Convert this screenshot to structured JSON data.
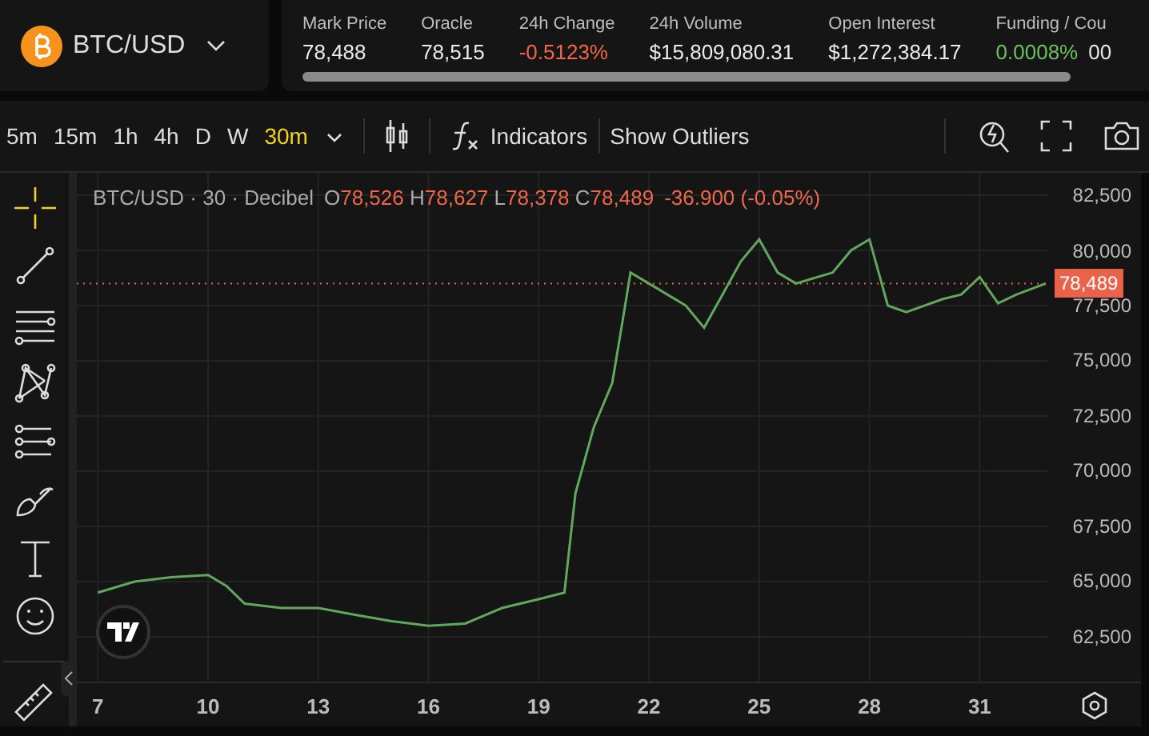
{
  "market": {
    "symbol": "BTC/USD"
  },
  "stats": [
    {
      "label": "Mark Price",
      "value": "78,488",
      "color": "#ececec"
    },
    {
      "label": "Oracle",
      "value": "78,515",
      "color": "#ececec"
    },
    {
      "label": "24h Change",
      "value": "-0.5123%",
      "color": "#f0664a"
    },
    {
      "label": "24h Volume",
      "value": "$15,809,080.31",
      "color": "#ececec"
    },
    {
      "label": "Open Interest",
      "value": "$1,272,384.17",
      "color": "#ececec"
    },
    {
      "label": "Funding / Cou",
      "value": "0.0008%",
      "extra": "00",
      "color": "#6cc05f"
    }
  ],
  "timeframes": [
    {
      "label": "5m",
      "selected": false
    },
    {
      "label": "15m",
      "selected": false
    },
    {
      "label": "1h",
      "selected": false
    },
    {
      "label": "4h",
      "selected": false
    },
    {
      "label": "D",
      "selected": false
    },
    {
      "label": "W",
      "selected": false
    },
    {
      "label": "30m",
      "selected": true
    }
  ],
  "toolbar": {
    "indicators": "Indicators",
    "outliers": "Show Outliers"
  },
  "tools": [
    {
      "selected": true
    },
    {
      "selected": false
    },
    {
      "selected": false
    },
    {
      "selected": false
    },
    {
      "selected": false
    },
    {
      "selected": false
    },
    {
      "selected": false
    },
    {
      "selected": false
    },
    {
      "selected": false
    }
  ],
  "legend": {
    "title": "BTC/USD · 30 · Decibel",
    "ohlc": [
      {
        "label": "O",
        "value": "78,526"
      },
      {
        "label": "H",
        "value": "78,627"
      },
      {
        "label": "L",
        "value": "78,378"
      },
      {
        "label": "C",
        "value": "78,489"
      }
    ],
    "change": "-36.900 (-0.05%)"
  },
  "price_tag": "78,489",
  "chart_data": {
    "type": "line",
    "x": [
      7,
      8,
      9,
      10,
      10.5,
      11,
      12,
      13,
      14,
      15,
      16,
      17,
      18,
      19,
      19.7,
      20,
      20.5,
      21,
      21.3,
      21.5,
      22,
      23,
      23.5,
      24,
      24.5,
      25,
      25.5,
      26,
      27,
      27.5,
      28,
      28.5,
      29,
      30,
      30.5,
      31,
      31.5,
      32,
      32.8
    ],
    "series": [
      {
        "color": "#5fa85c",
        "values": [
          64500,
          65000,
          65200,
          65300,
          64800,
          64000,
          63800,
          63800,
          63500,
          63200,
          63000,
          63100,
          63800,
          64200,
          64500,
          69000,
          72000,
          74000,
          77000,
          79000,
          78500,
          77500,
          76500,
          78000,
          79500,
          80500,
          79000,
          78500,
          79000,
          80000,
          80500,
          77500,
          77200,
          77800,
          78000,
          78800,
          77600,
          78000,
          78500
        ]
      }
    ],
    "grid": true,
    "ref_lines": [
      {
        "axis": "y",
        "value": 78500,
        "color": "#e8634a"
      }
    ],
    "xlim": [
      6.43,
      35.39
    ],
    "ylim": [
      60470,
      83515
    ],
    "xticks": [
      7,
      10,
      13,
      16,
      19,
      22,
      25,
      28,
      31
    ],
    "yticks": [
      {
        "value": 62500,
        "label": "62,500"
      },
      {
        "value": 65000,
        "label": "65,000"
      },
      {
        "value": 67500,
        "label": "67,500"
      },
      {
        "value": 70000,
        "label": "70,000"
      },
      {
        "value": 72500,
        "label": "72,500"
      },
      {
        "value": 75000,
        "label": "75,000"
      },
      {
        "value": 77500,
        "label": "77,500"
      },
      {
        "value": 80000,
        "label": "80,000"
      },
      {
        "value": 82500,
        "label": "82,500"
      }
    ]
  }
}
